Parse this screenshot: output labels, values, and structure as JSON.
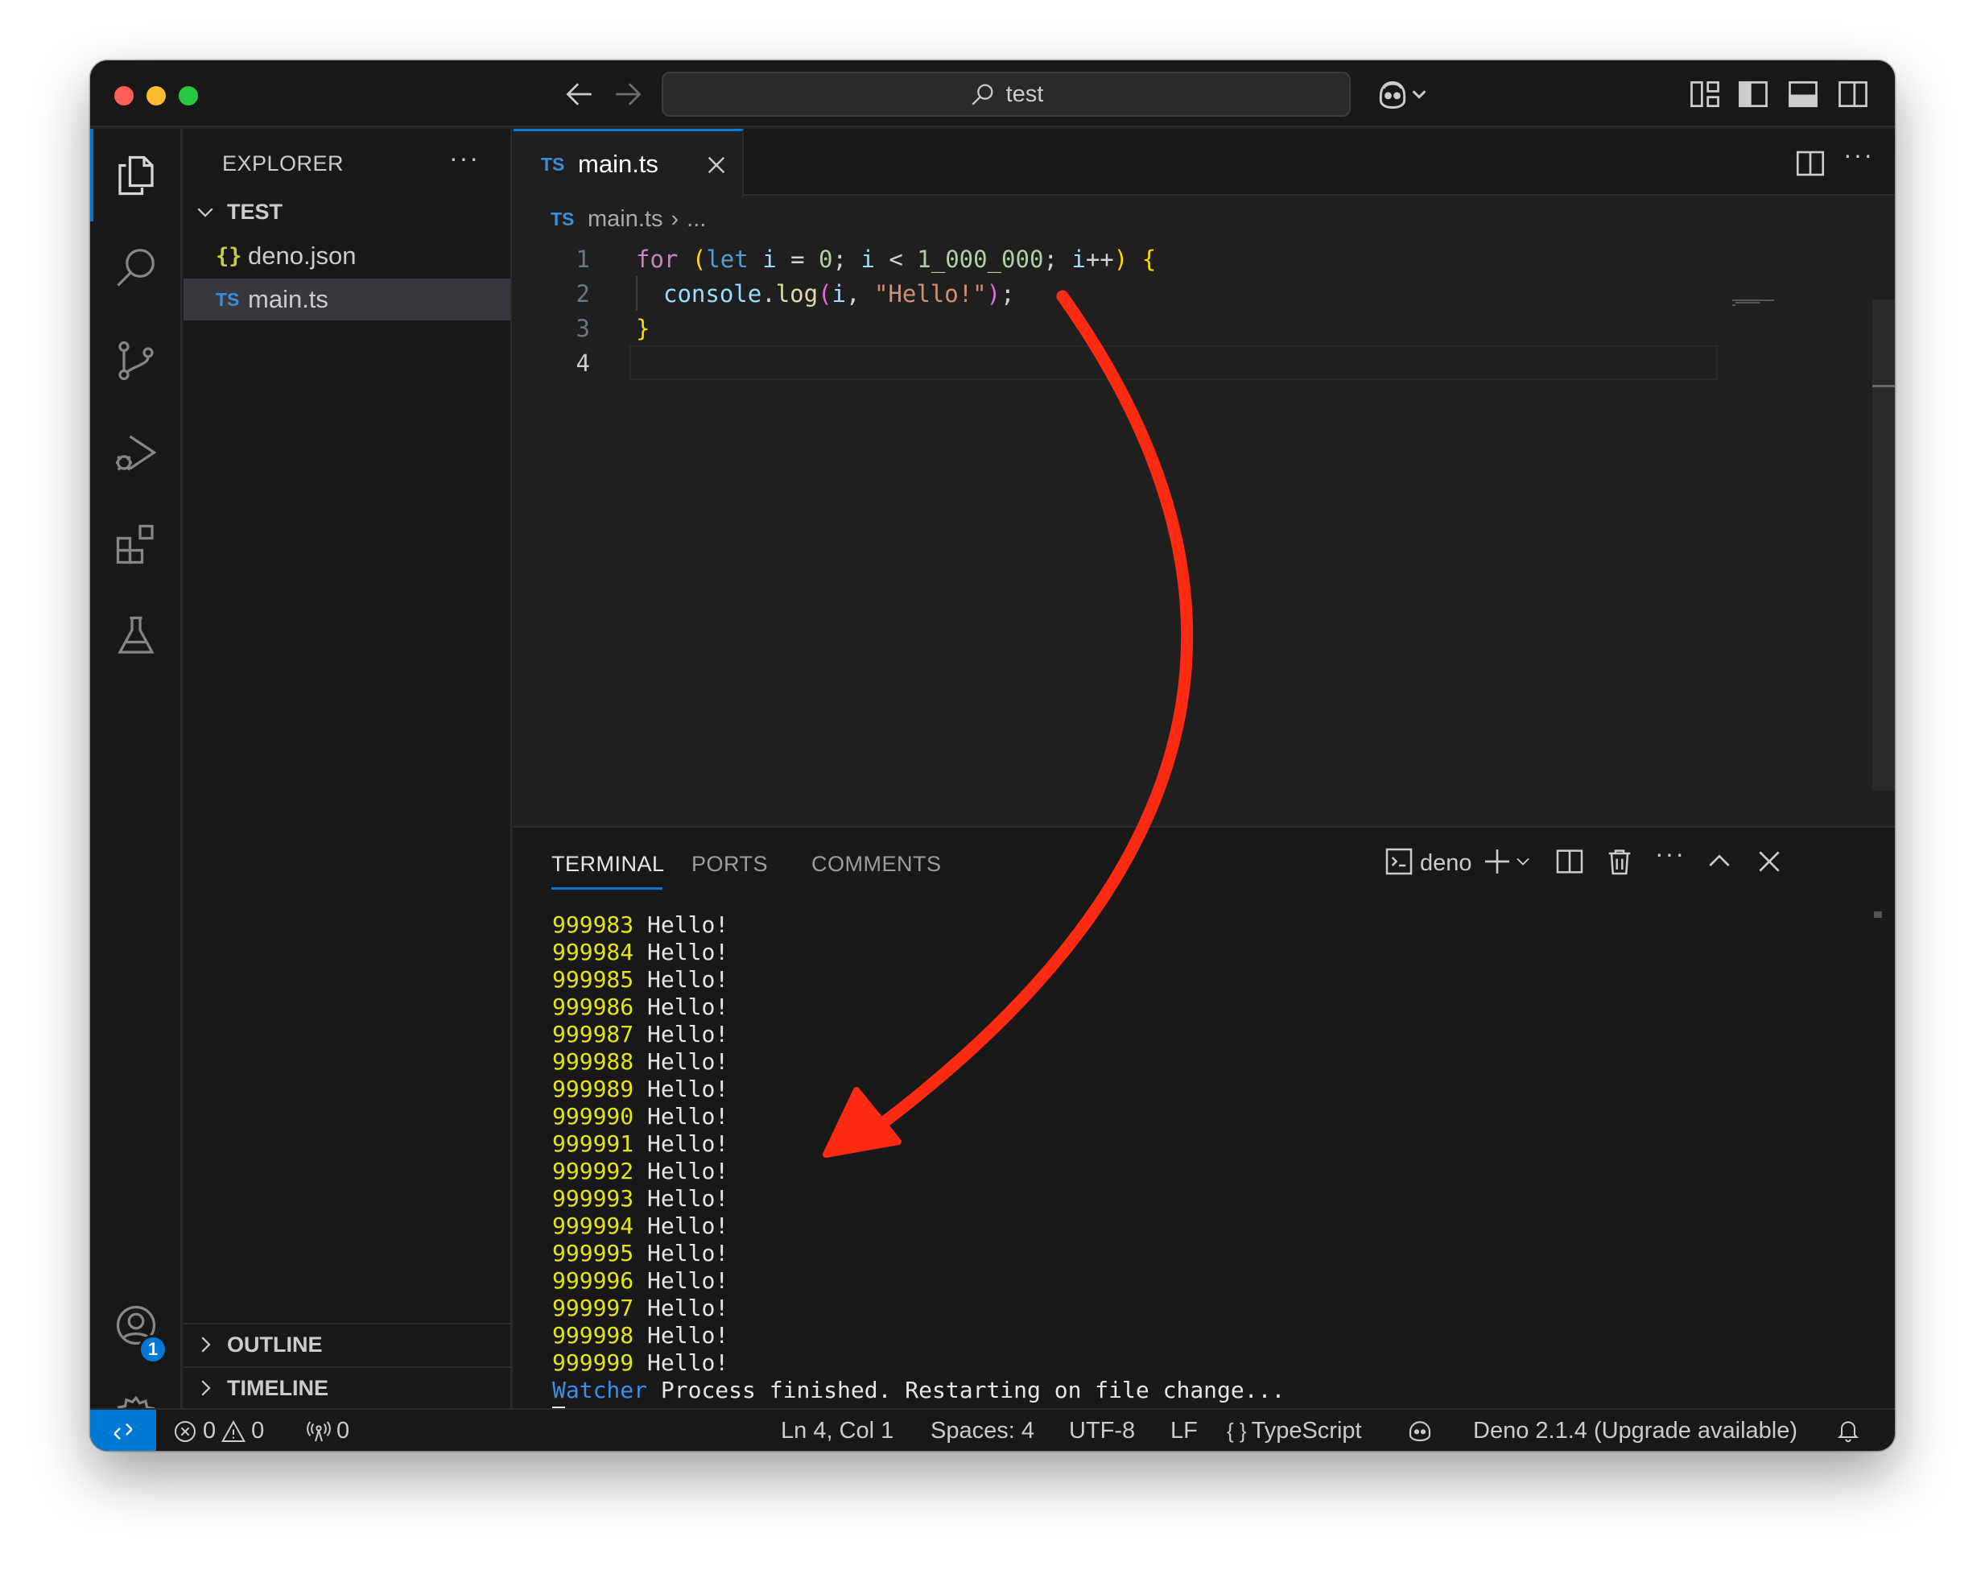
{
  "titlebar": {
    "search_text": "test"
  },
  "sidebar": {
    "title": "EXPLORER",
    "more": "···",
    "folder": "TEST",
    "files": [
      {
        "icon": "{}",
        "name": "deno.json"
      },
      {
        "icon": "TS",
        "name": "main.ts"
      }
    ],
    "sections": [
      "OUTLINE",
      "TIMELINE"
    ]
  },
  "activity": {
    "accounts_badge": "1"
  },
  "editor": {
    "tab": {
      "icon": "TS",
      "name": "main.ts"
    },
    "breadcrumb": {
      "icon": "TS",
      "file": "main.ts",
      "separator": "›",
      "rest": "..."
    },
    "more": "···",
    "line_numbers": [
      "1",
      "2",
      "3",
      "4"
    ],
    "code": {
      "l1": {
        "for": "for",
        "open": "(",
        "let": "let",
        "i1": "i",
        "eq": " = ",
        "zero": "0",
        "semi1": "; ",
        "i2": "i",
        "lt": " < ",
        "max": "1_000_000",
        "semi2": "; ",
        "i3": "i",
        "inc": "++",
        "close": ")",
        "brace": "{"
      },
      "l2": {
        "console": "console",
        "dot": ".",
        "log": "log",
        "open": "(",
        "arg": "i",
        "comma": ", ",
        "str": "\"Hello!\"",
        "close": ")",
        "semi": ";"
      },
      "l3": {
        "brace": "}"
      }
    }
  },
  "panel": {
    "tabs": [
      "TERMINAL",
      "PORTS",
      "COMMENTS"
    ],
    "terminal_name": "deno",
    "more": "···",
    "terminal_lines": [
      {
        "num": "999983",
        "text": " Hello!"
      },
      {
        "num": "999984",
        "text": " Hello!"
      },
      {
        "num": "999985",
        "text": " Hello!"
      },
      {
        "num": "999986",
        "text": " Hello!"
      },
      {
        "num": "999987",
        "text": " Hello!"
      },
      {
        "num": "999988",
        "text": " Hello!"
      },
      {
        "num": "999989",
        "text": " Hello!"
      },
      {
        "num": "999990",
        "text": " Hello!"
      },
      {
        "num": "999991",
        "text": " Hello!"
      },
      {
        "num": "999992",
        "text": " Hello!"
      },
      {
        "num": "999993",
        "text": " Hello!"
      },
      {
        "num": "999994",
        "text": " Hello!"
      },
      {
        "num": "999995",
        "text": " Hello!"
      },
      {
        "num": "999996",
        "text": " Hello!"
      },
      {
        "num": "999997",
        "text": " Hello!"
      },
      {
        "num": "999998",
        "text": " Hello!"
      },
      {
        "num": "999999",
        "text": " Hello!"
      }
    ],
    "watcher_label": "Watcher",
    "watcher_text": " Process finished. Restarting on file change..."
  },
  "statusbar": {
    "errors": "0",
    "warnings": "0",
    "ports": "0",
    "position": "Ln 4, Col 1",
    "spaces": "Spaces: 4",
    "encoding": "UTF-8",
    "eol": "LF",
    "language_icon": "{ }",
    "language": "TypeScript",
    "deno": "Deno 2.1.4 (Upgrade available)"
  },
  "colors": {
    "accent": "#0078d4",
    "annotation_arrow": "#ff2a12",
    "terminal_number": "#e5e510",
    "watcher": "#3b8eea"
  }
}
